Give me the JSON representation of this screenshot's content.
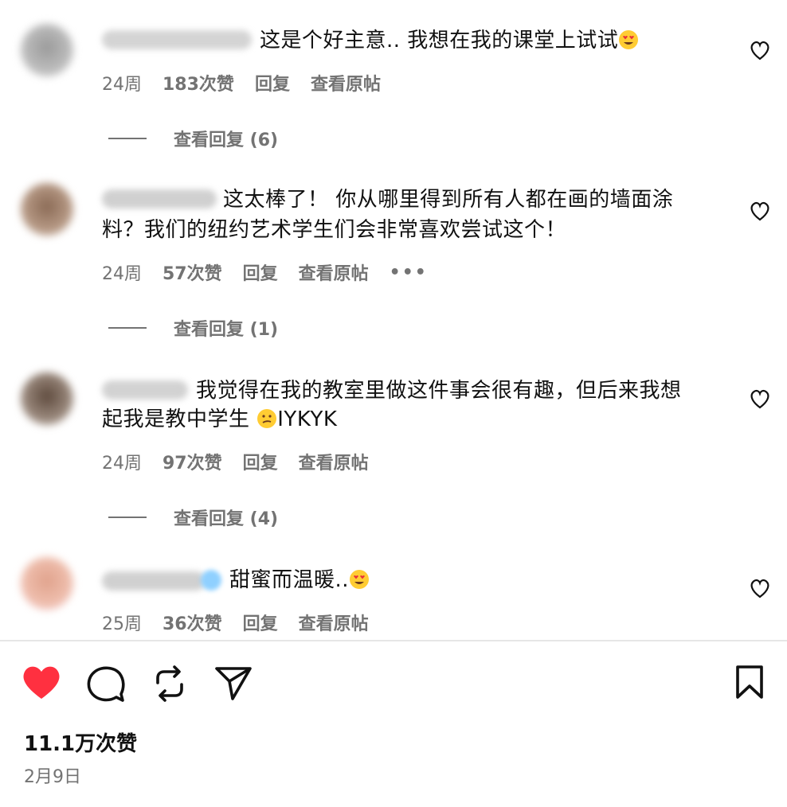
{
  "comments": [
    {
      "text_lines": [
        "这是个好主意.. 我想在我的课堂上试试"
      ],
      "age": "24周",
      "likes": "183次赞",
      "reply": "回复",
      "translate": "查看原帖",
      "view_replies": "查看回复 (6)"
    },
    {
      "text_lines": [
        "这太棒了！ 你从哪里得到所有人都在画的墙面涂",
        "料？我们的纽约艺术学生们会非常喜欢尝试这个！"
      ],
      "age": "24周",
      "likes": "57次赞",
      "reply": "回复",
      "translate": "查看原帖",
      "more": "•••",
      "view_replies": "查看回复 (1)"
    },
    {
      "text_lines": [
        "我觉得在我的教室里做这件事会很有趣，但后来我想",
        "起我是教中学生 ",
        "IYKYK"
      ],
      "age": "24周",
      "likes": "97次赞",
      "reply": "回复",
      "translate": "查看原帖",
      "view_replies": "查看回复 (4)"
    },
    {
      "text_lines": [
        "甜蜜而温暖.."
      ],
      "age": "25周",
      "likes": "36次赞",
      "reply": "回复",
      "translate": "查看原帖"
    }
  ],
  "post": {
    "likes": "11.1万次赞",
    "date": "2月9日"
  },
  "icons": {
    "like": "heart-filled-icon",
    "comment": "comment-bubble-icon",
    "repost": "repost-icon",
    "share": "send-icon",
    "save": "bookmark-icon",
    "comment_like": "heart-outline-icon"
  },
  "colors": {
    "liked": "#ff3040",
    "muted": "#737373",
    "text": "#111111"
  }
}
